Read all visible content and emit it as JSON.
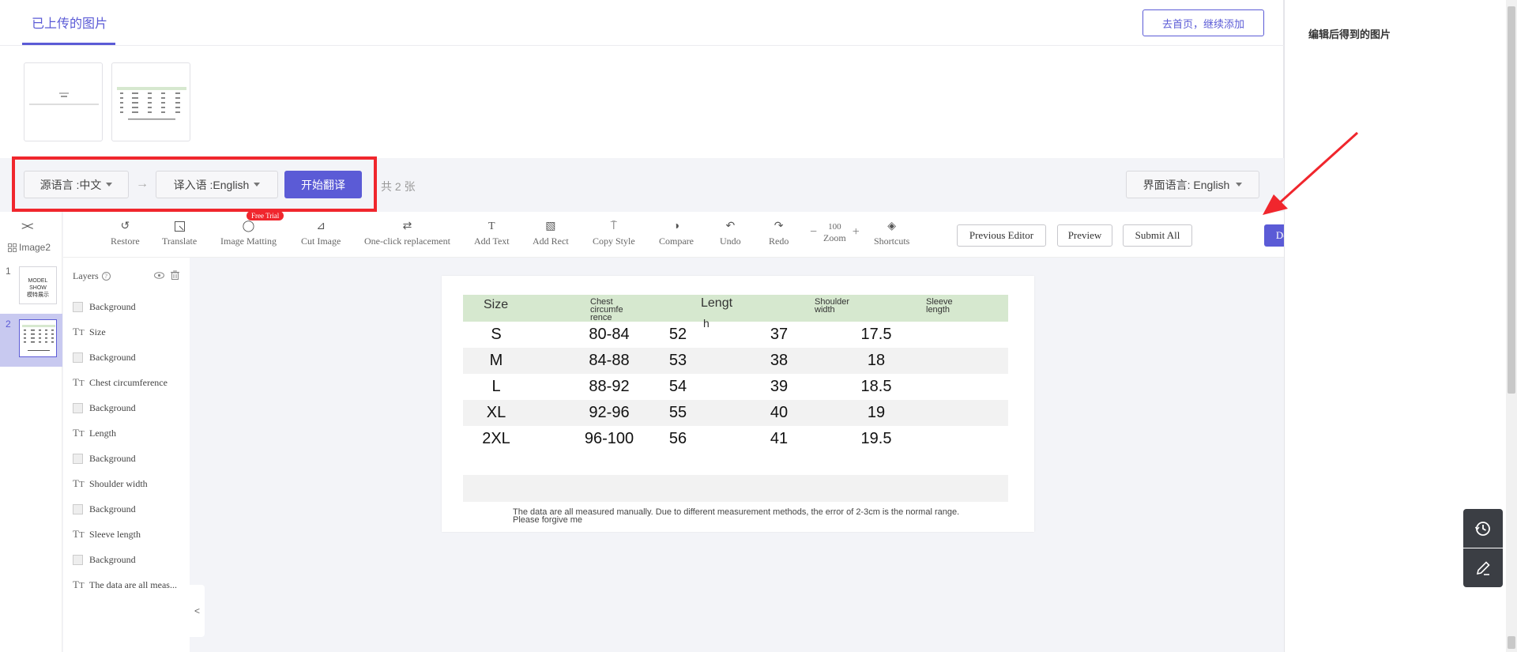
{
  "header": {
    "tab_active": "已上传的图片",
    "home_button": "去首页，继续添加"
  },
  "translate_bar": {
    "source_lang": "源语言 :中文",
    "target_lang": "译入语 :English",
    "start_button": "开始翻译",
    "count": "共 2 张",
    "ui_lang": "界面语言: English"
  },
  "right_panel": {
    "title": "编辑后得到的图片"
  },
  "image_list": {
    "label": "Image2",
    "items": [
      {
        "num": "1"
      },
      {
        "num": "2"
      }
    ]
  },
  "layers": {
    "title": "Layers",
    "items": [
      {
        "type": "bg",
        "label": "Background"
      },
      {
        "type": "text",
        "label": "Size"
      },
      {
        "type": "bg",
        "label": "Background"
      },
      {
        "type": "text",
        "label": "Chest circumference"
      },
      {
        "type": "bg",
        "label": "Background"
      },
      {
        "type": "text",
        "label": "Length"
      },
      {
        "type": "bg",
        "label": "Background"
      },
      {
        "type": "text",
        "label": "Shoulder width"
      },
      {
        "type": "bg",
        "label": "Background"
      },
      {
        "type": "text",
        "label": "Sleeve length"
      },
      {
        "type": "bg",
        "label": "Background"
      },
      {
        "type": "text",
        "label": "The data are all meas..."
      }
    ]
  },
  "toolbar": {
    "restore": "Restore",
    "translate": "Translate",
    "free_trial": "Free Trial",
    "image_matting": "Image Matting",
    "cut_image": "Cut Image",
    "one_click": "One-click replacement",
    "add_text": "Add Text",
    "add_rect": "Add Rect",
    "copy_style": "Copy Style",
    "compare": "Compare",
    "undo": "Undo",
    "redo": "Redo",
    "zoom_value": "100",
    "zoom_label": "Zoom",
    "shortcuts": "Shortcuts",
    "previous_editor": "Previous Editor",
    "preview": "Preview",
    "submit_all": "Submit All",
    "download": "Download"
  },
  "size_table": {
    "headers": {
      "size": "Size",
      "chest": "Chest\ncircumfe\nrence",
      "length_a": "Lengt",
      "length_b": "h",
      "shoulder": "Shoulder\nwidth",
      "sleeve": "Sleeve\nlength"
    },
    "rows": [
      [
        "S",
        "80-84",
        "52",
        "37",
        "17.5"
      ],
      [
        "M",
        "84-88",
        "53",
        "38",
        "18"
      ],
      [
        "L",
        "88-92",
        "54",
        "39",
        "18.5"
      ],
      [
        "XL",
        "92-96",
        "55",
        "40",
        "19"
      ],
      [
        "2XL",
        "96-100",
        "56",
        "41",
        "19.5"
      ]
    ],
    "note": "The data are all measured manually. Due to different measurement methods, the error of 2-3cm is the normal range. Please forgive me"
  },
  "thumb1_text": {
    "line1": "MODEL SHOW",
    "line2": "模特展示"
  },
  "colors": {
    "accent": "#5b5bd6",
    "annotation_red": "#f0262d",
    "table_header": "#d6e8cf"
  }
}
